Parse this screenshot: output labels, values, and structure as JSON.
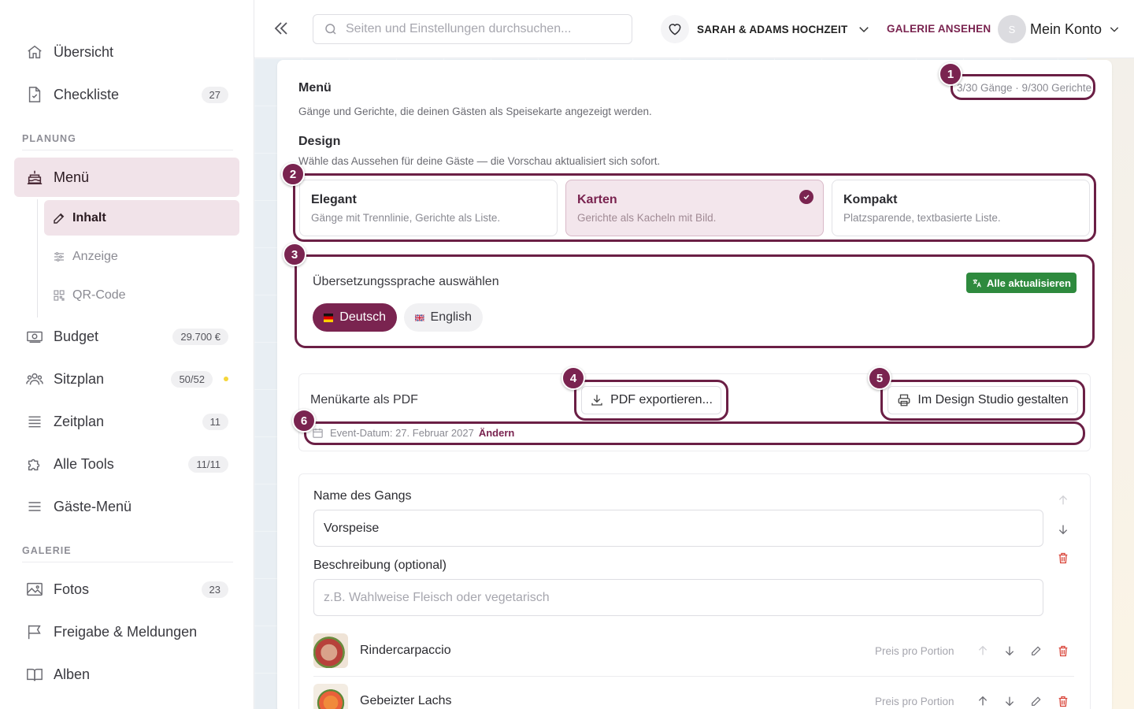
{
  "sidebar": {
    "items": [
      {
        "label": "Übersicht",
        "icon": "home-icon"
      },
      {
        "label": "Checkliste",
        "icon": "checklist-icon",
        "badge": "27"
      }
    ],
    "section_planung": "PLANUNG",
    "menu": {
      "label": "Menü",
      "icon": "cake-icon",
      "active": true
    },
    "sub_items": [
      {
        "label": "Inhalt",
        "icon": "edit-icon",
        "active": true
      },
      {
        "label": "Anzeige",
        "icon": "sliders-icon"
      },
      {
        "label": "QR-Code",
        "icon": "qr-icon"
      }
    ],
    "planning_items": [
      {
        "label": "Budget",
        "icon": "money-icon",
        "badge": "29.700 €"
      },
      {
        "label": "Sitzplan",
        "icon": "people-icon",
        "badge": "50/52"
      },
      {
        "label": "Zeitplan",
        "icon": "list-icon",
        "badge": "11"
      },
      {
        "label": "Alle Tools",
        "icon": "puzzle-icon",
        "badge": "11/11"
      },
      {
        "label": "Gäste-Menü",
        "icon": "hamburger-icon"
      }
    ],
    "section_galerie": "GALERIE",
    "gallery_items": [
      {
        "label": "Fotos",
        "icon": "photo-icon",
        "badge": "23"
      },
      {
        "label": "Freigabe & Meldungen",
        "icon": "flag-icon"
      },
      {
        "label": "Alben",
        "icon": "book-icon"
      }
    ]
  },
  "topbar": {
    "search_placeholder": "Seiten und Einstellungen durchsuchen...",
    "event_name": "SARAH & ADAMS HOCHZEIT",
    "gallery_link": "GALERIE ANSEHEN",
    "avatar_initial": "S",
    "account_label": "Mein Konto"
  },
  "menu_page": {
    "title": "Menü",
    "subtitle": "Gänge und Gerichte, die deinen Gästen als Speisekarte angezeigt werden.",
    "counter": "3/30 Gänge · 9/300 Gerichte",
    "design_title": "Design",
    "design_subtitle": "Wähle das Aussehen für deine Gäste — die Vorschau aktualisiert sich sofort.",
    "designs": [
      {
        "title": "Elegant",
        "desc": "Gänge mit Trennlinie, Gerichte als Liste."
      },
      {
        "title": "Karten",
        "desc": "Gerichte als Kacheln mit Bild.",
        "selected": true
      },
      {
        "title": "Kompakt",
        "desc": "Platzsparende, textbasierte Liste."
      }
    ],
    "language_title": "Übersetzungssprache auswählen",
    "update_all": "Alle aktualisieren",
    "languages": [
      {
        "label": "Deutsch",
        "active": true
      },
      {
        "label": "English",
        "active": false
      }
    ],
    "pdf_title": "Menükarte als PDF",
    "pdf_export": "PDF exportieren...",
    "design_studio": "Im Design Studio gestalten",
    "event_date": "Event-Datum: 27. Februar 2027",
    "event_date_change": "Ändern",
    "course_name_label": "Name des Gangs",
    "course_name_value": "Vorspeise",
    "description_label": "Beschreibung (optional)",
    "description_placeholder": "z.B. Wahlweise Fleisch oder vegetarisch",
    "dishes": [
      {
        "name": "Rindercarpaccio",
        "price": "Preis pro Portion"
      },
      {
        "name": "Gebeizter Lachs",
        "price": "Preis pro Portion"
      }
    ]
  },
  "annotations": [
    "1",
    "2",
    "3",
    "4",
    "5",
    "6"
  ],
  "colors": {
    "accent": "#7a2450",
    "accent_light": "#f1e3e9",
    "success": "#2e8a3e",
    "danger": "#d9453a"
  }
}
